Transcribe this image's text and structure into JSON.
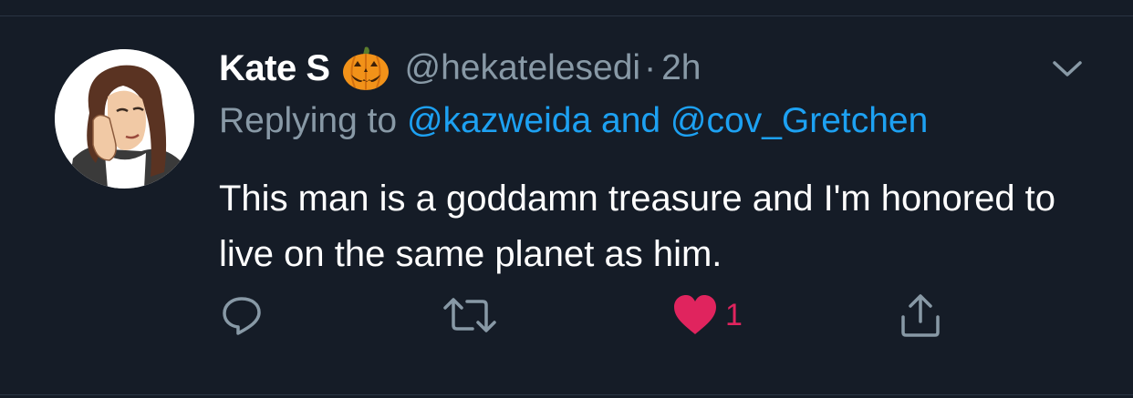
{
  "tweet": {
    "author_name": "Kate S",
    "author_emoji": "jack-o-lantern",
    "handle": "@hekatelesedi",
    "separator": "·",
    "time": "2h",
    "replying_prefix": "Replying to",
    "reply_user_1": "@kazweida",
    "reply_conjunction": "and",
    "reply_user_2": "@cov_Gretchen",
    "text": "This man is a goddamn treasure and I'm honored to live on the same planet as him."
  },
  "actions": {
    "reply_icon": "reply-icon",
    "retweet_icon": "retweet-icon",
    "like_icon": "heart-icon",
    "like_count": "1",
    "share_icon": "share-icon"
  },
  "colors": {
    "background": "#151c27",
    "text": "#ffffff",
    "secondary": "#8899a6",
    "link": "#1da1f2",
    "like": "#e0245e"
  }
}
